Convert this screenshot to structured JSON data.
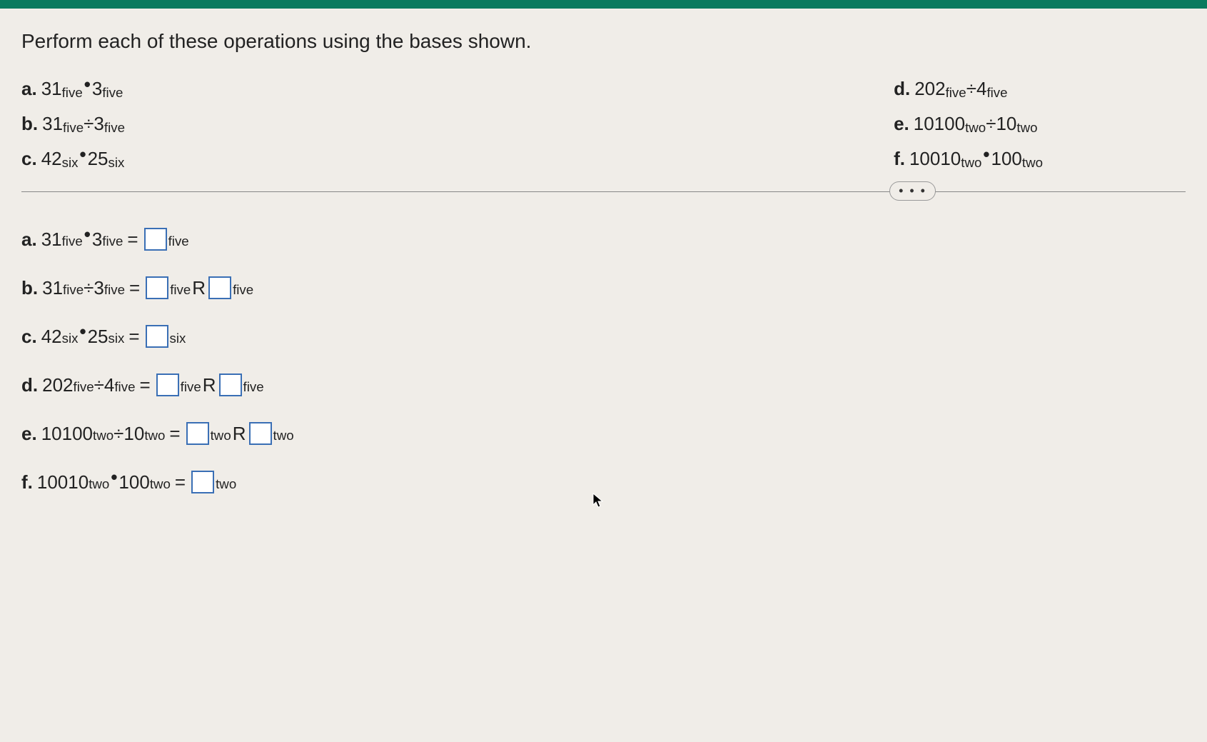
{
  "instruction": "Perform each of these operations using the bases shown.",
  "top_problems": {
    "left": [
      {
        "label": "a.",
        "n1": "31",
        "b1": "five",
        "op": "dot",
        "n2": "3",
        "b2": "five"
      },
      {
        "label": "b.",
        "n1": "31",
        "b1": "five",
        "op": "div",
        "n2": "3",
        "b2": "five"
      },
      {
        "label": "c.",
        "n1": "42",
        "b1": "six",
        "op": "dot",
        "n2": "25",
        "b2": "six"
      }
    ],
    "right": [
      {
        "label": "d.",
        "n1": "202",
        "b1": "five",
        "op": "div",
        "n2": "4",
        "b2": "five"
      },
      {
        "label": "e.",
        "n1": "10100",
        "b1": "two",
        "op": "div",
        "n2": "10",
        "b2": "two"
      },
      {
        "label": "f.",
        "n1": "10010",
        "b1": "two",
        "op": "dot",
        "n2": "100",
        "b2": "two"
      }
    ]
  },
  "ellipsis": "• • •",
  "answers": [
    {
      "label": "a.",
      "n1": "31",
      "b1": "five",
      "op": "dot",
      "n2": "3",
      "b2": "five",
      "ans_bases": [
        "five"
      ],
      "remainder": false
    },
    {
      "label": "b.",
      "n1": "31",
      "b1": "five",
      "op": "div",
      "n2": "3",
      "b2": "five",
      "ans_bases": [
        "five",
        "five"
      ],
      "remainder": true
    },
    {
      "label": "c.",
      "n1": "42",
      "b1": "six",
      "op": "dot",
      "n2": "25",
      "b2": "six",
      "ans_bases": [
        "six"
      ],
      "remainder": false
    },
    {
      "label": "d.",
      "n1": "202",
      "b1": "five",
      "op": "div",
      "n2": "4",
      "b2": "five",
      "ans_bases": [
        "five",
        "five"
      ],
      "remainder": true
    },
    {
      "label": "e.",
      "n1": "10100",
      "b1": "two",
      "op": "div",
      "n2": "10",
      "b2": "two",
      "ans_bases": [
        "two",
        "two"
      ],
      "remainder": true
    },
    {
      "label": "f.",
      "n1": "10010",
      "b1": "two",
      "op": "dot",
      "n2": "100",
      "b2": "two",
      "ans_bases": [
        "two"
      ],
      "remainder": false
    }
  ],
  "symbols": {
    "dot": "•",
    "div": "÷",
    "eq": "=",
    "R": "R"
  }
}
